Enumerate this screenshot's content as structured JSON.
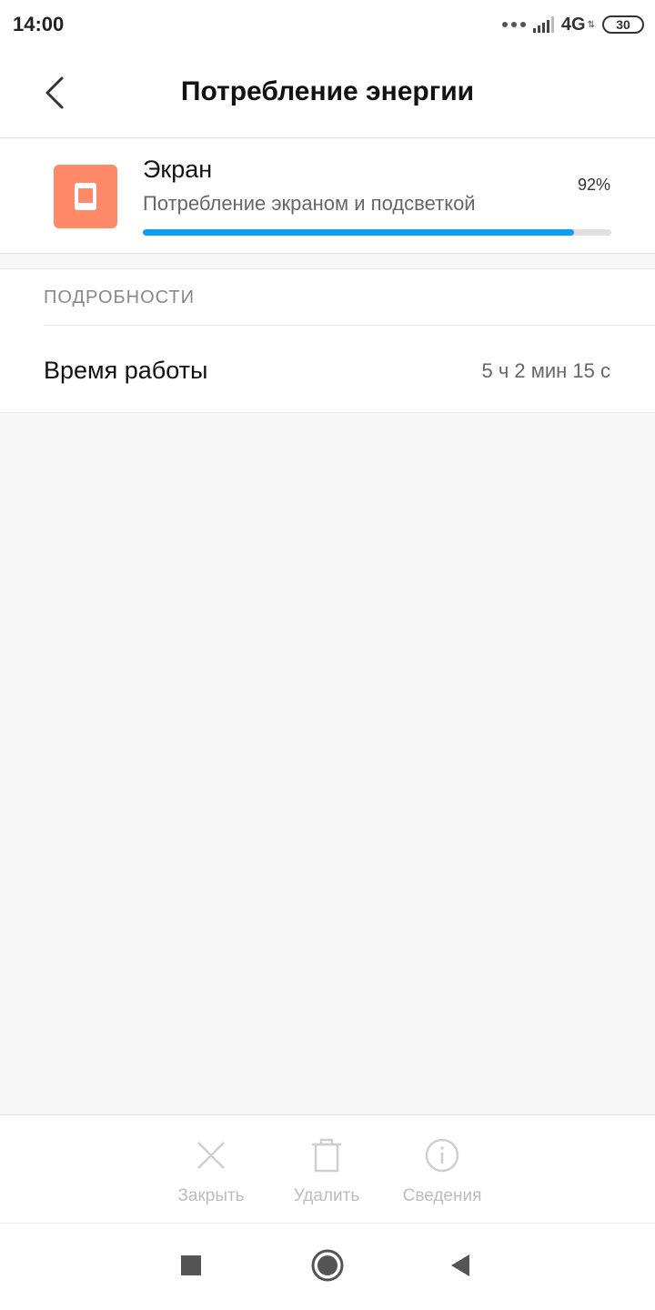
{
  "status_bar": {
    "time": "14:00",
    "network": "4G",
    "battery": "30"
  },
  "header": {
    "title": "Потребление энергии",
    "back_icon": "chevron-left-icon"
  },
  "summary": {
    "app_name": "Экран",
    "description": "Потребление экраном и подсветкой",
    "percent_label": "92%",
    "usage_fraction": 0.92,
    "icon": "phone-screen-icon",
    "icon_color": "#fe8a6a",
    "progress_color": "#0e9bf5"
  },
  "details": {
    "section_title": "ПОДРОБНОСТИ",
    "uptime_label": "Время работы",
    "uptime_value": "5 ч 2 мин 15 с"
  },
  "actions": [
    {
      "label": "Закрыть",
      "icon": "close-icon"
    },
    {
      "label": "Удалить",
      "icon": "trash-icon"
    },
    {
      "label": "Сведения",
      "icon": "info-icon"
    }
  ],
  "nav": {
    "recents_icon": "square-icon",
    "home_icon": "circle-icon",
    "back_icon": "triangle-back-icon"
  }
}
